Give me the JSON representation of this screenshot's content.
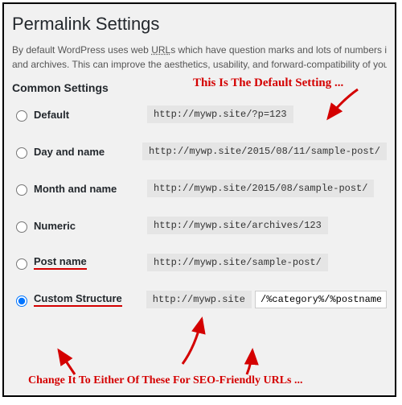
{
  "page": {
    "title": "Permalink Settings",
    "description_a": "By default WordPress uses web ",
    "description_u": "URL",
    "description_b": "s which have question marks and lots of numbers in them; ho",
    "description_c": "and archives. This can improve the aesthetics, usability, and forward-compatibility of your links. A"
  },
  "section": {
    "heading": "Common Settings"
  },
  "options": {
    "default": {
      "label": "Default",
      "url": "http://mywp.site/?p=123"
    },
    "dayname": {
      "label": "Day and name",
      "url": "http://mywp.site/2015/08/11/sample-post/"
    },
    "monthname": {
      "label": "Month and name",
      "url": "http://mywp.site/2015/08/sample-post/"
    },
    "numeric": {
      "label": "Numeric",
      "url": "http://mywp.site/archives/123"
    },
    "postname": {
      "label": "Post name",
      "url": "http://mywp.site/sample-post/"
    },
    "custom": {
      "label": "Custom Structure",
      "base": "http://mywp.site",
      "value": "/%category%/%postname%"
    }
  },
  "annotations": {
    "top": "This Is The Default Setting ...",
    "bottom": "Change It To Either Of These For SEO-Friendly URLs ..."
  }
}
